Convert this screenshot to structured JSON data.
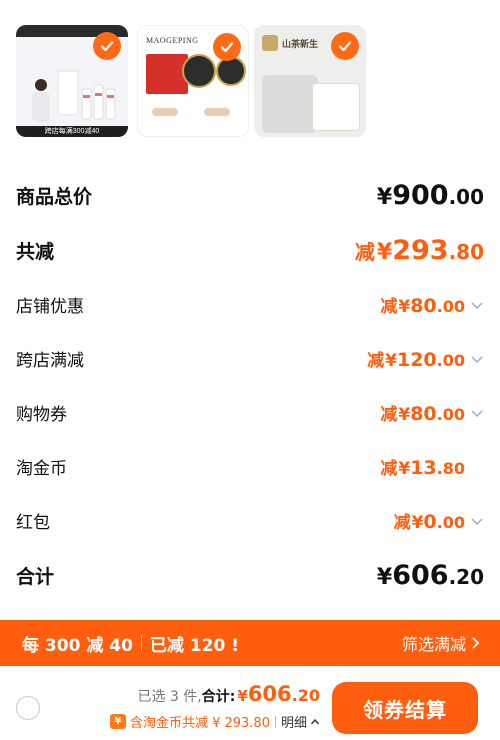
{
  "products": [
    {
      "band_text": "跨店每满300减40"
    },
    {
      "brand": "MAOGEPING"
    },
    {
      "title": "山茶新生"
    }
  ],
  "summary": {
    "total_price": {
      "label": "商品总价",
      "yen": "¥",
      "int": "900",
      "dec": ".00"
    },
    "total_discount": {
      "label": "共减",
      "prefix": "减",
      "yen": "¥",
      "int": "293",
      "dec": ".80"
    },
    "lines": [
      {
        "label": "店铺优惠",
        "prefix": "减",
        "yen": "¥",
        "int": "80",
        "dec": ".00",
        "expandable": true
      },
      {
        "label": "跨店满减",
        "prefix": "减",
        "yen": "¥",
        "int": "120",
        "dec": ".00",
        "expandable": true
      },
      {
        "label": "购物券",
        "prefix": "减",
        "yen": "¥",
        "int": "80",
        "dec": ".00",
        "expandable": true
      },
      {
        "label": "淘金币",
        "prefix": "减",
        "yen": "¥",
        "int": "13",
        "dec": ".80",
        "expandable": false
      },
      {
        "label": "红包",
        "prefix": "减",
        "yen": "¥",
        "int": "0",
        "dec": ".00",
        "expandable": true
      }
    ],
    "grand_total": {
      "label": "合计",
      "yen": "¥",
      "int": "606",
      "dec": ".20"
    }
  },
  "promo": {
    "rule": "每 300 减 40",
    "achieved": "已减 120 !",
    "filter_label": "筛选满减"
  },
  "bottom": {
    "selected": "已选 3 件,",
    "total_label": "合计:",
    "yen": "¥",
    "int": "606",
    "dec": ".20",
    "coin_icon": "¥",
    "coin_text": "含淘金币共减 ¥ 293.80",
    "detail_label": "明细",
    "checkout_label": "领券结算"
  },
  "colors": {
    "accent": "#ff5e0e",
    "check": "#ff6a17"
  }
}
